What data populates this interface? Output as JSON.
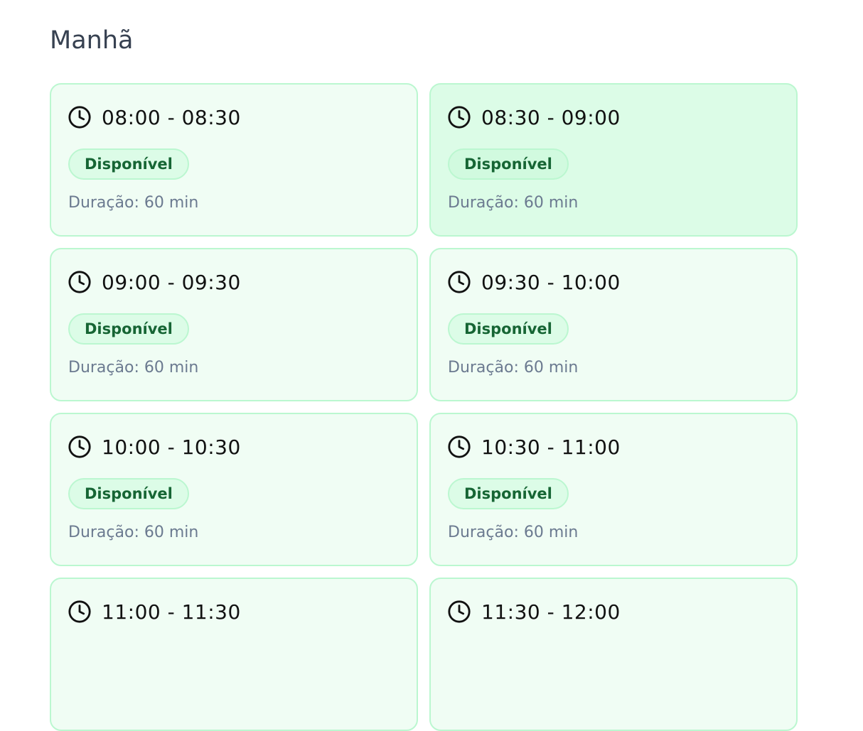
{
  "section": {
    "title": "Manhã"
  },
  "slots": [
    {
      "time": "08:00 - 08:30",
      "status": "Disponível",
      "duration": "Duração: 60 min"
    },
    {
      "time": "08:30 - 09:00",
      "status": "Disponível",
      "duration": "Duração: 60 min"
    },
    {
      "time": "09:00 - 09:30",
      "status": "Disponível",
      "duration": "Duração: 60 min"
    },
    {
      "time": "09:30 - 10:00",
      "status": "Disponível",
      "duration": "Duração: 60 min"
    },
    {
      "time": "10:00 - 10:30",
      "status": "Disponível",
      "duration": "Duração: 60 min"
    },
    {
      "time": "10:30 - 11:00",
      "status": "Disponível",
      "duration": "Duração: 60 min"
    },
    {
      "time": "11:00 - 11:30"
    },
    {
      "time": "11:30 - 12:00"
    }
  ],
  "icons": {
    "clock": "clock-icon"
  },
  "colors": {
    "card_background": "#f0fdf4",
    "card_hover_background": "#dcfce7",
    "card_border": "#bbf7d0",
    "badge_text": "#166534",
    "muted_text": "#6b7a90",
    "heading_text": "#374151"
  }
}
